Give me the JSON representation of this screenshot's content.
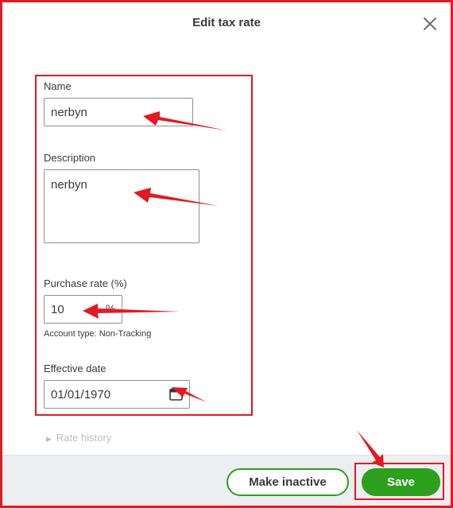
{
  "dialog": {
    "title": "Edit tax rate",
    "close_icon": "close-icon"
  },
  "form": {
    "name": {
      "label": "Name",
      "value": "nerbyn"
    },
    "description": {
      "label": "Description",
      "value": "nerbyn"
    },
    "purchase_rate": {
      "label": "Purchase rate (%)",
      "value": "10",
      "suffix": "%",
      "note": "Account type: Non-Tracking"
    },
    "effective_date": {
      "label": "Effective date",
      "value": "01/01/1970",
      "icon": "calendar-icon"
    }
  },
  "rate_history": {
    "label": "Rate history",
    "icon": "triangle-right-icon"
  },
  "footer": {
    "make_inactive_label": "Make inactive",
    "save_label": "Save"
  },
  "colors": {
    "annotation_red": "#e21a22",
    "brand_green": "#2ca01c",
    "text": "#393a3d",
    "footer_bg": "#eceef1"
  }
}
